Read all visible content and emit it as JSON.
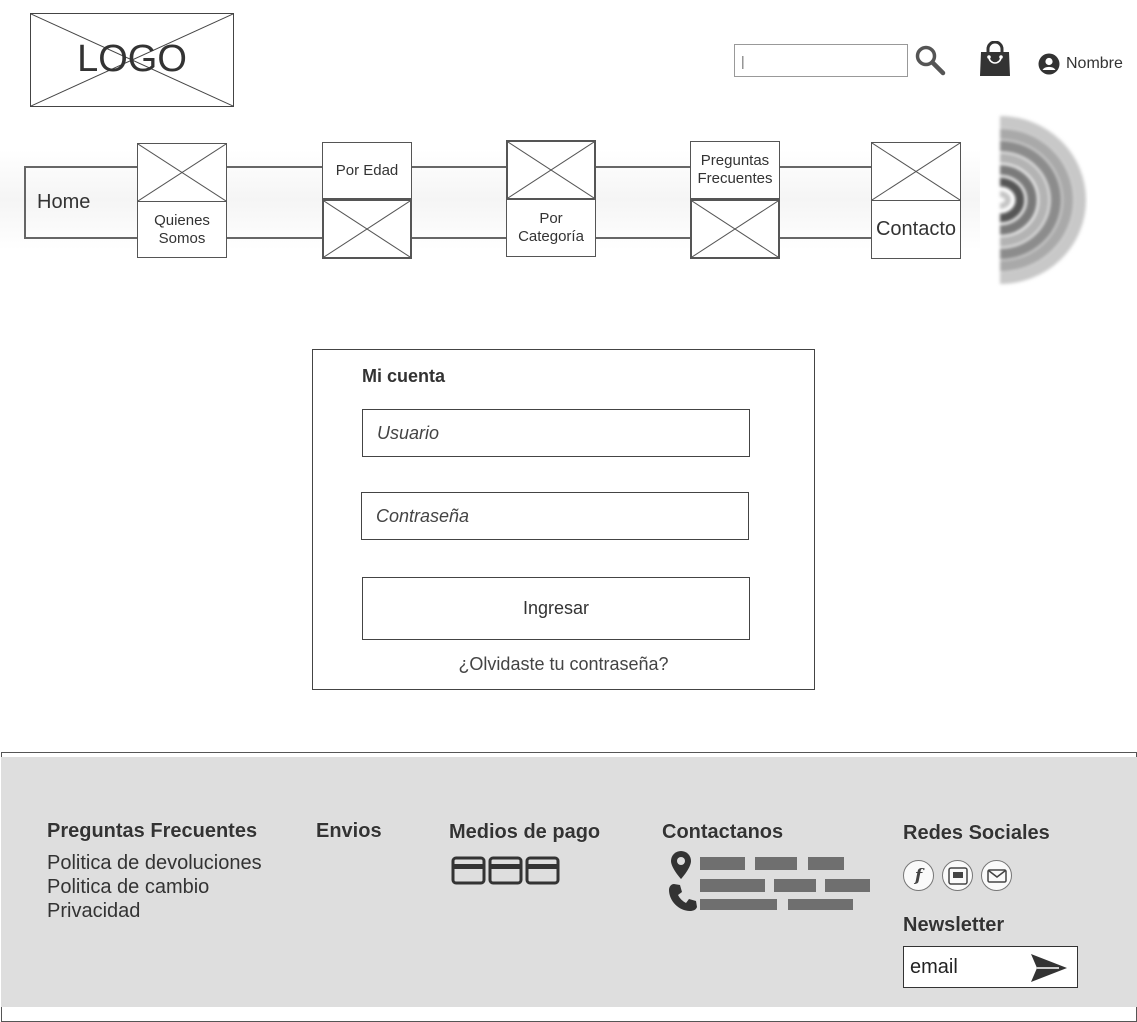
{
  "header": {
    "logo_text": "LOGO",
    "search": {
      "value": "",
      "placeholder": "|"
    },
    "icons": {
      "search": "search-icon",
      "cart": "shopping-bag-icon",
      "user": "user-circle-icon"
    },
    "user_name": "Nombre"
  },
  "nav": {
    "items": [
      {
        "label": "Home"
      },
      {
        "label": "Quienes Somos"
      },
      {
        "label": "Por Edad"
      },
      {
        "label": "Por Categoría"
      },
      {
        "label": "Preguntas Frecuentes"
      },
      {
        "label": "Contacto"
      }
    ],
    "brand_mark": "rainbow-arcs-icon"
  },
  "login": {
    "title": "Mi cuenta",
    "username_placeholder": "Usuario",
    "password_placeholder": "Contraseña",
    "submit_label": "Ingresar",
    "forgot_label": "¿Olvidaste tu contraseña?"
  },
  "footer": {
    "faq": {
      "title": "Preguntas Frecuentes",
      "links": [
        "Politica de devoluciones",
        "Politica de cambio",
        "Privacidad"
      ]
    },
    "shipping": {
      "title": "Envios"
    },
    "payment": {
      "title": "Medios de pago",
      "icons": [
        "credit-card-icon",
        "credit-card-icon",
        "credit-card-icon"
      ]
    },
    "contact": {
      "title": "Contactanos",
      "icons": [
        "location-pin-icon",
        "phone-icon"
      ]
    },
    "social": {
      "title": "Redes Sociales",
      "icons": [
        "facebook-icon",
        "video-icon",
        "mail-icon"
      ]
    },
    "newsletter": {
      "title": "Newsletter",
      "placeholder": "email"
    }
  },
  "colors": {
    "footer_bg": "#dedede",
    "text": "#333333",
    "placeholder_bar": "#6f6f6f"
  }
}
